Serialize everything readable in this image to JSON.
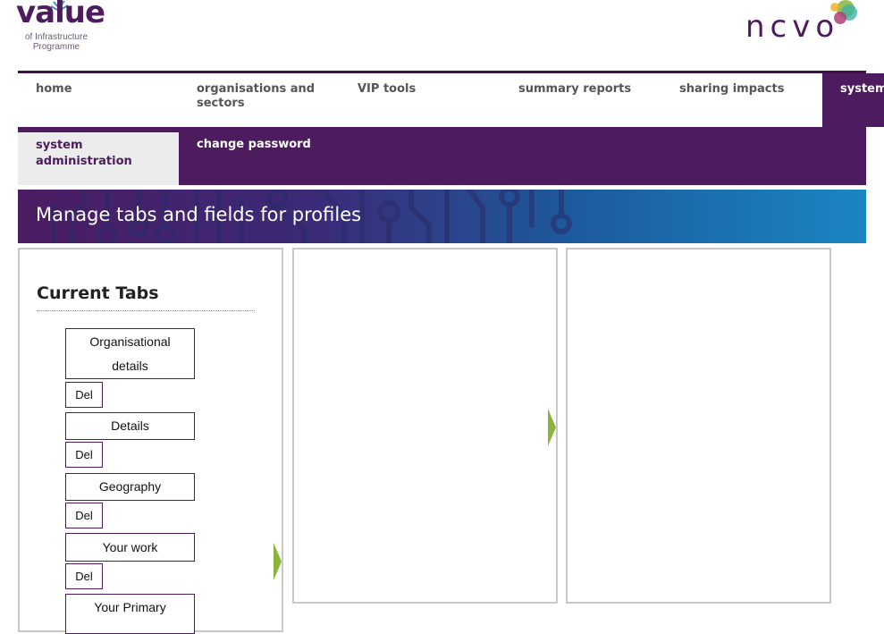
{
  "logos": {
    "vip": {
      "word": "value",
      "sub_line1": "of Infrastructure",
      "sub_line2": "Programme"
    },
    "ncvo": {
      "word": "ncvo"
    }
  },
  "topnav": {
    "items": [
      {
        "label": "home"
      },
      {
        "label": "organisations and sectors"
      },
      {
        "label": "VIP tools"
      },
      {
        "label": "summary reports"
      },
      {
        "label": "sharing impacts"
      },
      {
        "label": "system administration"
      }
    ]
  },
  "subnav": {
    "active_label_line1": "system",
    "active_label_line2": "administration",
    "change_password": "change password"
  },
  "banner": {
    "title": "Manage tabs and fields for profiles"
  },
  "current_tabs": {
    "heading": "Current Tabs",
    "del_label": "Del",
    "tabs": [
      {
        "line1": "Organisational",
        "line2": "details"
      },
      {
        "line1": "Details"
      },
      {
        "line1": "Geography"
      },
      {
        "line1": "Your work"
      },
      {
        "line1": "Your Primary"
      }
    ]
  },
  "colors": {
    "brand_purple": "#4d1c5e",
    "accent_green": "#8ab53a",
    "banner_blue": "#1a86c2"
  }
}
